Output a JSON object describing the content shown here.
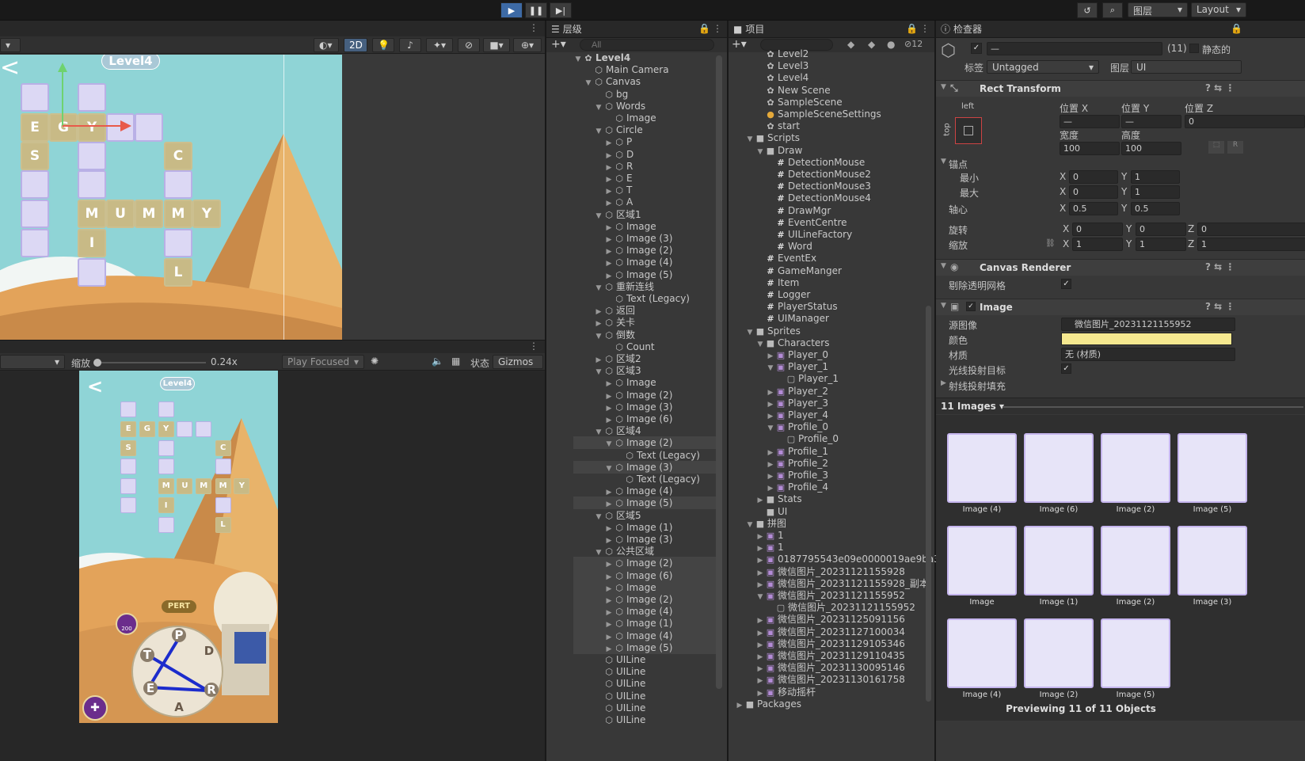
{
  "toolbar": {
    "layers_label": "图层",
    "layout_label": "Layout"
  },
  "scene": {
    "toolbar_2d": "2D",
    "level_label": "Level4",
    "word_tiles": [
      {
        "c": "",
        "f": false
      },
      {
        "c": "",
        "f": false
      },
      {
        "c": "E",
        "f": true
      },
      {
        "c": "G",
        "f": true
      },
      {
        "c": "Y",
        "f": true
      },
      {
        "c": "",
        "f": false
      },
      {
        "c": "",
        "f": false
      },
      {
        "c": "S",
        "f": true
      },
      {
        "c": "",
        "f": false
      },
      {
        "c": "C",
        "f": true
      },
      {
        "c": "",
        "f": false
      },
      {
        "c": "",
        "f": false
      },
      {
        "c": "",
        "f": false
      },
      {
        "c": "",
        "f": false
      },
      {
        "c": "M",
        "f": true
      },
      {
        "c": "U",
        "f": true
      },
      {
        "c": "M",
        "f": true
      },
      {
        "c": "M",
        "f": true
      },
      {
        "c": "Y",
        "f": true
      },
      {
        "c": "",
        "f": false
      },
      {
        "c": "I",
        "f": true
      },
      {
        "c": "",
        "f": false
      },
      {
        "c": "",
        "f": false
      },
      {
        "c": "L",
        "f": true
      }
    ]
  },
  "game": {
    "scale_label": "缩放",
    "scale_value": "0.24x",
    "play_focused": "Play Focused",
    "status_label": "状态",
    "gizmos_label": "Gizmos",
    "level_label": "Level4",
    "pert": "PERT",
    "coins": "200",
    "back": "<",
    "circle_letters": [
      "P",
      "D",
      "T",
      "E",
      "R",
      "A"
    ]
  },
  "hierarchy": {
    "tab": "层级",
    "search_placeholder": "All",
    "rows": [
      {
        "d": 0,
        "a": "▼",
        "t": "Level4",
        "b": true,
        "i": "scene"
      },
      {
        "d": 1,
        "a": "",
        "t": "Main Camera"
      },
      {
        "d": 1,
        "a": "▼",
        "t": "Canvas"
      },
      {
        "d": 2,
        "a": "",
        "t": "bg"
      },
      {
        "d": 2,
        "a": "▼",
        "t": "Words"
      },
      {
        "d": 3,
        "a": "",
        "t": "Image"
      },
      {
        "d": 2,
        "a": "▼",
        "t": "Circle"
      },
      {
        "d": 3,
        "a": "▶",
        "t": "P"
      },
      {
        "d": 3,
        "a": "▶",
        "t": "D"
      },
      {
        "d": 3,
        "a": "▶",
        "t": "R"
      },
      {
        "d": 3,
        "a": "▶",
        "t": "E"
      },
      {
        "d": 3,
        "a": "▶",
        "t": "T"
      },
      {
        "d": 3,
        "a": "▶",
        "t": "A"
      },
      {
        "d": 2,
        "a": "▼",
        "t": "区域1"
      },
      {
        "d": 3,
        "a": "▶",
        "t": "Image"
      },
      {
        "d": 3,
        "a": "▶",
        "t": "Image (3)"
      },
      {
        "d": 3,
        "a": "▶",
        "t": "Image (2)"
      },
      {
        "d": 3,
        "a": "▶",
        "t": "Image (4)"
      },
      {
        "d": 3,
        "a": "▶",
        "t": "Image (5)"
      },
      {
        "d": 2,
        "a": "▼",
        "t": "重新连线"
      },
      {
        "d": 3,
        "a": "",
        "t": "Text (Legacy)"
      },
      {
        "d": 2,
        "a": "▶",
        "t": "返回"
      },
      {
        "d": 2,
        "a": "▶",
        "t": "关卡"
      },
      {
        "d": 2,
        "a": "▼",
        "t": "倒数"
      },
      {
        "d": 3,
        "a": "",
        "t": "Count"
      },
      {
        "d": 2,
        "a": "▶",
        "t": "区域2"
      },
      {
        "d": 2,
        "a": "▼",
        "t": "区域3"
      },
      {
        "d": 3,
        "a": "▶",
        "t": "Image"
      },
      {
        "d": 3,
        "a": "▶",
        "t": "Image (2)"
      },
      {
        "d": 3,
        "a": "▶",
        "t": "Image (3)"
      },
      {
        "d": 3,
        "a": "▶",
        "t": "Image (6)"
      },
      {
        "d": 2,
        "a": "▼",
        "t": "区域4"
      },
      {
        "d": 3,
        "a": "▼",
        "t": "Image (2)",
        "h": true
      },
      {
        "d": 4,
        "a": "",
        "t": "Text (Legacy)"
      },
      {
        "d": 3,
        "a": "▼",
        "t": "Image (3)",
        "h": true
      },
      {
        "d": 4,
        "a": "",
        "t": "Text (Legacy)"
      },
      {
        "d": 3,
        "a": "▶",
        "t": "Image (4)"
      },
      {
        "d": 3,
        "a": "▶",
        "t": "Image (5)",
        "h": true
      },
      {
        "d": 2,
        "a": "▼",
        "t": "区域5"
      },
      {
        "d": 3,
        "a": "▶",
        "t": "Image (1)"
      },
      {
        "d": 3,
        "a": "▶",
        "t": "Image (3)"
      },
      {
        "d": 2,
        "a": "▼",
        "t": "公共区域"
      },
      {
        "d": 3,
        "a": "▶",
        "t": "Image (2)",
        "h": true
      },
      {
        "d": 3,
        "a": "▶",
        "t": "Image (6)",
        "h": true
      },
      {
        "d": 3,
        "a": "▶",
        "t": "Image",
        "h": true
      },
      {
        "d": 3,
        "a": "▶",
        "t": "Image (2)",
        "h": true
      },
      {
        "d": 3,
        "a": "▶",
        "t": "Image (4)",
        "h": true
      },
      {
        "d": 3,
        "a": "▶",
        "t": "Image (1)",
        "h": true
      },
      {
        "d": 3,
        "a": "▶",
        "t": "Image (4)",
        "h": true
      },
      {
        "d": 3,
        "a": "▶",
        "t": "Image (5)",
        "h": true
      },
      {
        "d": 2,
        "a": "",
        "t": "UILine"
      },
      {
        "d": 2,
        "a": "",
        "t": "UILine"
      },
      {
        "d": 2,
        "a": "",
        "t": "UILine"
      },
      {
        "d": 2,
        "a": "",
        "t": "UILine"
      },
      {
        "d": 2,
        "a": "",
        "t": "UILine"
      },
      {
        "d": 2,
        "a": "",
        "t": "UILine"
      }
    ]
  },
  "project": {
    "tab": "项目",
    "hidden_count": "12",
    "rows": [
      {
        "d": 2,
        "a": "",
        "t": "Level2",
        "i": "scene"
      },
      {
        "d": 2,
        "a": "",
        "t": "Level3",
        "i": "scene"
      },
      {
        "d": 2,
        "a": "",
        "t": "Level4",
        "i": "scene"
      },
      {
        "d": 2,
        "a": "",
        "t": "New Scene",
        "i": "scene"
      },
      {
        "d": 2,
        "a": "",
        "t": "SampleScene",
        "i": "scene"
      },
      {
        "d": 2,
        "a": "",
        "t": "SampleSceneSettings",
        "i": "settings"
      },
      {
        "d": 2,
        "a": "",
        "t": "start",
        "i": "scene"
      },
      {
        "d": 1,
        "a": "▼",
        "t": "Scripts",
        "i": "folder"
      },
      {
        "d": 2,
        "a": "▼",
        "t": "Draw",
        "i": "folder"
      },
      {
        "d": 3,
        "a": "",
        "t": "DetectionMouse",
        "i": "cs"
      },
      {
        "d": 3,
        "a": "",
        "t": "DetectionMouse2",
        "i": "cs"
      },
      {
        "d": 3,
        "a": "",
        "t": "DetectionMouse3",
        "i": "cs"
      },
      {
        "d": 3,
        "a": "",
        "t": "DetectionMouse4",
        "i": "cs"
      },
      {
        "d": 3,
        "a": "",
        "t": "DrawMgr",
        "i": "cs"
      },
      {
        "d": 3,
        "a": "",
        "t": "EventCentre",
        "i": "cs"
      },
      {
        "d": 3,
        "a": "",
        "t": "UILineFactory",
        "i": "cs"
      },
      {
        "d": 3,
        "a": "",
        "t": "Word",
        "i": "cs"
      },
      {
        "d": 2,
        "a": "",
        "t": "EventEx",
        "i": "cs"
      },
      {
        "d": 2,
        "a": "",
        "t": "GameManger",
        "i": "cs"
      },
      {
        "d": 2,
        "a": "",
        "t": "Item",
        "i": "cs"
      },
      {
        "d": 2,
        "a": "",
        "t": "Logger",
        "i": "cs"
      },
      {
        "d": 2,
        "a": "",
        "t": "PlayerStatus",
        "i": "cs"
      },
      {
        "d": 2,
        "a": "",
        "t": "UIManager",
        "i": "cs"
      },
      {
        "d": 1,
        "a": "▼",
        "t": "Sprites",
        "i": "folder"
      },
      {
        "d": 2,
        "a": "▼",
        "t": "Characters",
        "i": "folder"
      },
      {
        "d": 3,
        "a": "▶",
        "t": "Player_0",
        "i": "img"
      },
      {
        "d": 3,
        "a": "▼",
        "t": "Player_1",
        "i": "img"
      },
      {
        "d": 4,
        "a": "",
        "t": "Player_1",
        "i": "spr"
      },
      {
        "d": 3,
        "a": "▶",
        "t": "Player_2",
        "i": "img"
      },
      {
        "d": 3,
        "a": "▶",
        "t": "Player_3",
        "i": "img"
      },
      {
        "d": 3,
        "a": "▶",
        "t": "Player_4",
        "i": "img"
      },
      {
        "d": 3,
        "a": "▼",
        "t": "Profile_0",
        "i": "img"
      },
      {
        "d": 4,
        "a": "",
        "t": "Profile_0",
        "i": "spr"
      },
      {
        "d": 3,
        "a": "▶",
        "t": "Profile_1",
        "i": "img"
      },
      {
        "d": 3,
        "a": "▶",
        "t": "Profile_2",
        "i": "img"
      },
      {
        "d": 3,
        "a": "▶",
        "t": "Profile_3",
        "i": "img"
      },
      {
        "d": 3,
        "a": "▶",
        "t": "Profile_4",
        "i": "img"
      },
      {
        "d": 2,
        "a": "▶",
        "t": "Stats",
        "i": "folder"
      },
      {
        "d": 2,
        "a": "",
        "t": "UI",
        "i": "folder"
      },
      {
        "d": 1,
        "a": "▼",
        "t": "拼图",
        "i": "folder"
      },
      {
        "d": 2,
        "a": "▶",
        "t": "1",
        "i": "img"
      },
      {
        "d": 2,
        "a": "▶",
        "t": "1",
        "i": "img"
      },
      {
        "d": 2,
        "a": "▶",
        "t": "0187795543e09e0000019ae9ba38",
        "i": "img"
      },
      {
        "d": 2,
        "a": "▶",
        "t": "微信图片_20231121155928",
        "i": "img"
      },
      {
        "d": 2,
        "a": "▶",
        "t": "微信图片_20231121155928_副本",
        "i": "img"
      },
      {
        "d": 2,
        "a": "▼",
        "t": "微信图片_20231121155952",
        "i": "img"
      },
      {
        "d": 3,
        "a": "",
        "t": "微信图片_20231121155952",
        "i": "spr"
      },
      {
        "d": 2,
        "a": "▶",
        "t": "微信图片_20231125091156",
        "i": "img"
      },
      {
        "d": 2,
        "a": "▶",
        "t": "微信图片_20231127100034",
        "i": "img"
      },
      {
        "d": 2,
        "a": "▶",
        "t": "微信图片_20231129105346",
        "i": "img"
      },
      {
        "d": 2,
        "a": "▶",
        "t": "微信图片_20231129110435",
        "i": "img"
      },
      {
        "d": 2,
        "a": "▶",
        "t": "微信图片_20231130095146",
        "i": "img"
      },
      {
        "d": 2,
        "a": "▶",
        "t": "微信图片_20231130161758",
        "i": "img"
      },
      {
        "d": 2,
        "a": "▶",
        "t": "移动摇杆",
        "i": "img"
      },
      {
        "d": 0,
        "a": "▶",
        "t": "Packages",
        "i": "folder"
      }
    ]
  },
  "inspector": {
    "tab": "检查器",
    "obj_name": "—",
    "count": "(11)",
    "static_label": "静态的",
    "tag_label": "标签",
    "tag_value": "Untagged",
    "layer_label": "图层",
    "layer_value": "UI",
    "rect": {
      "title": "Rect Transform",
      "left": "left",
      "top": "top",
      "posx": "位置 X",
      "posy": "位置 Y",
      "posz": "位置 Z",
      "posx_v": "—",
      "posy_v": "—",
      "posz_v": "0",
      "w": "宽度",
      "h": "高度",
      "w_v": "100",
      "h_v": "100",
      "anchors": "锚点",
      "min": "最小",
      "max": "最大",
      "min_x": "0",
      "min_y": "1",
      "max_x": "0",
      "max_y": "1",
      "pivot": "轴心",
      "pivot_x": "0.5",
      "pivot_y": "0.5",
      "rot": "旋转",
      "rot_x": "0",
      "rot_y": "0",
      "rot_z": "0",
      "scale": "缩放",
      "sc_x": "1",
      "sc_y": "1",
      "sc_z": "1",
      "X": "X",
      "Y": "Y",
      "Z": "Z"
    },
    "canvas": {
      "title": "Canvas Renderer",
      "cull": "剔除透明网格"
    },
    "image": {
      "title": "Image",
      "src": "源图像",
      "src_v": "微信图片_20231121155952",
      "color": "颜色",
      "color_hex": "#f5e88f",
      "mat": "材质",
      "mat_v": "无 (材质)",
      "raycast": "光线投射目标",
      "pad": "射线投射填充"
    },
    "preview": {
      "header": "11 Images",
      "footer": "Previewing 11 of 11 Objects",
      "items": [
        "Image (4)",
        "Image (6)",
        "Image (2)",
        "Image (5)",
        "Image",
        "Image (1)",
        "Image (2)",
        "Image (3)",
        "Image (4)",
        "Image (2)",
        "Image (5)"
      ]
    }
  }
}
